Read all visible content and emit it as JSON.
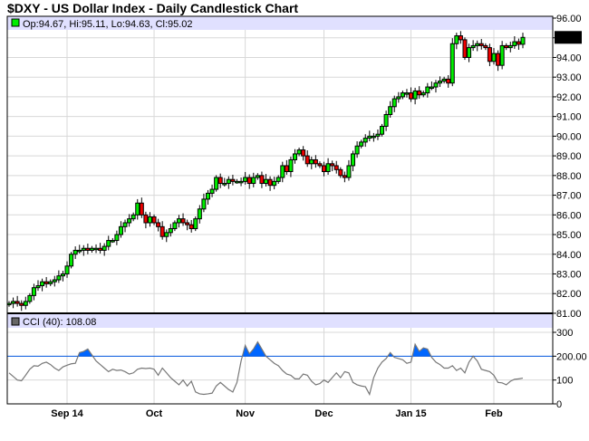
{
  "title": "$DXY - US Dollar Index - Daily Candlestick Chart",
  "chart_data": {
    "type": "candlestick",
    "title": "$DXY - US Dollar Index - Daily Candlestick Chart",
    "legend_price": "Op:94.67, Hi:95.11, Lo:94.63, Cl:95.02",
    "last_price_label": "95.02",
    "colors": {
      "up": "#00ee00",
      "down": "#ee0000",
      "band": "#e0e0ff",
      "cci_fill": "#0066ff",
      "cci_line": "#777777",
      "ref_line": "#0055dd"
    },
    "price_axis": {
      "min": 81,
      "max": 96,
      "ticks": [
        "81.00",
        "82.00",
        "83.00",
        "84.00",
        "85.00",
        "86.00",
        "87.00",
        "88.00",
        "89.00",
        "90.00",
        "91.00",
        "92.00",
        "93.00",
        "94.00",
        "95.00",
        "96.00"
      ]
    },
    "x_ticks": [
      {
        "label": "Sep 14",
        "index": 14
      },
      {
        "label": "Oct",
        "index": 35
      },
      {
        "label": "Nov",
        "index": 57
      },
      {
        "label": "Dec",
        "index": 76
      },
      {
        "label": "Jan 15",
        "index": 97
      },
      {
        "label": "Feb",
        "index": 117
      }
    ],
    "closes": [
      81.5,
      81.6,
      81.5,
      81.4,
      81.6,
      81.9,
      82.3,
      82.4,
      82.6,
      82.5,
      82.6,
      82.7,
      82.9,
      83.0,
      83.4,
      84.0,
      84.2,
      84.2,
      84.3,
      84.2,
      84.3,
      84.3,
      84.2,
      84.4,
      84.7,
      84.7,
      85.0,
      85.4,
      85.6,
      85.8,
      86.0,
      86.6,
      86.0,
      85.6,
      85.9,
      85.6,
      85.4,
      84.9,
      85.1,
      85.3,
      85.6,
      85.8,
      85.6,
      85.5,
      85.3,
      85.8,
      86.3,
      86.8,
      87.1,
      87.3,
      87.9,
      87.6,
      87.6,
      87.8,
      87.7,
      87.7,
      87.7,
      87.9,
      87.6,
      87.9,
      88.0,
      87.6,
      87.8,
      87.5,
      87.7,
      87.9,
      88.5,
      88.2,
      88.8,
      89.1,
      89.3,
      89.0,
      88.6,
      88.8,
      88.6,
      88.5,
      88.2,
      88.6,
      88.5,
      88.3,
      88.0,
      87.9,
      88.5,
      89.1,
      89.5,
      89.7,
      89.9,
      90.0,
      90.0,
      90.1,
      90.5,
      91.1,
      91.5,
      91.9,
      92.0,
      92.2,
      92.2,
      91.9,
      92.3,
      92.1,
      92.2,
      92.5,
      92.5,
      92.7,
      92.8,
      92.9,
      92.7,
      94.7,
      95.1,
      94.9,
      94.0,
      94.5,
      94.6,
      94.7,
      94.6,
      94.5,
      93.8,
      94.2,
      93.6,
      94.6,
      94.5,
      94.6,
      94.8,
      94.67,
      95.02
    ],
    "cci": {
      "label": "CCI (40): 108.08",
      "axis_ticks": [
        "0",
        "100",
        "200.00",
        "300"
      ],
      "reference_level": 200,
      "min": 0,
      "max": 380,
      "values": [
        130,
        115,
        100,
        97,
        120,
        145,
        160,
        158,
        170,
        175,
        165,
        150,
        140,
        155,
        162,
        168,
        170,
        215,
        220,
        230,
        205,
        180,
        165,
        150,
        135,
        145,
        140,
        142,
        135,
        125,
        130,
        145,
        150,
        148,
        150,
        145,
        120,
        150,
        130,
        110,
        95,
        80,
        100,
        75,
        95,
        50,
        42,
        40,
        42,
        45,
        75,
        90,
        75,
        60,
        50,
        90,
        180,
        245,
        210,
        230,
        260,
        230,
        200,
        185,
        170,
        160,
        140,
        125,
        120,
        105,
        105,
        125,
        120,
        95,
        80,
        85,
        100,
        90,
        110,
        130,
        110,
        135,
        130,
        90,
        80,
        75,
        72,
        40,
        110,
        150,
        175,
        190,
        215,
        195,
        190,
        185,
        170,
        175,
        250,
        220,
        235,
        230,
        195,
        175,
        165,
        150,
        150,
        160,
        140,
        150,
        130,
        175,
        200,
        180,
        145,
        140,
        135,
        120,
        90,
        88,
        80,
        95,
        103,
        105,
        108.08
      ]
    }
  }
}
